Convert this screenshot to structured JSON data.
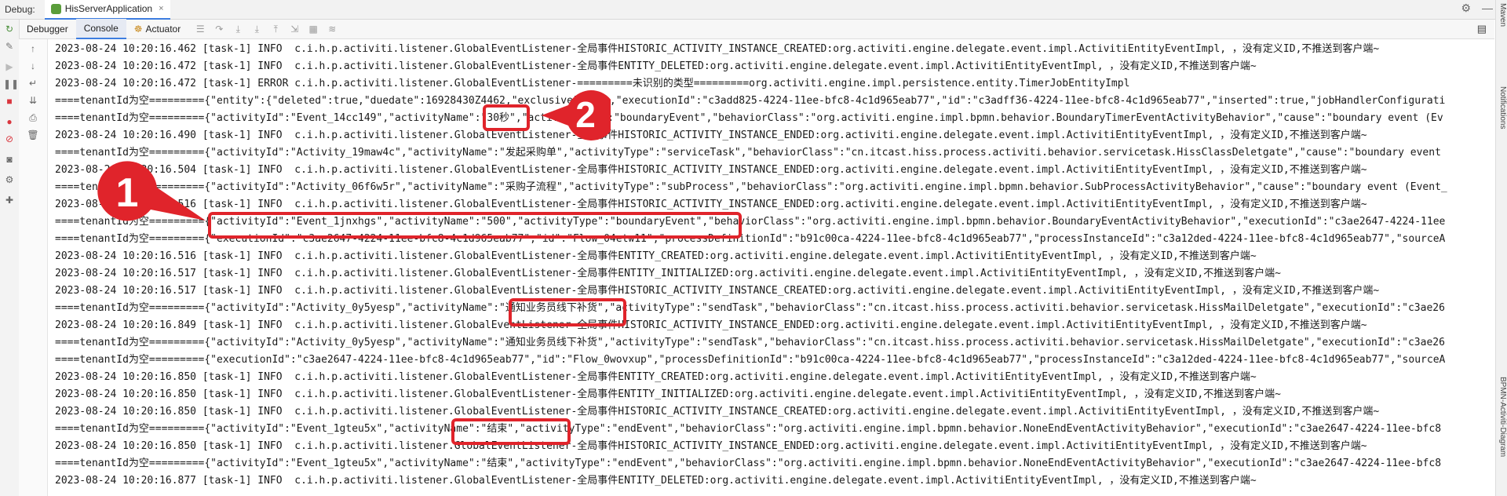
{
  "header": {
    "debug_label": "Debug:",
    "app_tab": "HisServerApplication",
    "close_symbol": "×",
    "settings_icon": "gear-icon",
    "minimize_icon": "minus-icon"
  },
  "toolbar": {
    "tabs": [
      "Debugger",
      "Console",
      "Actuator"
    ],
    "active_tab": "Console"
  },
  "right_panels": {
    "top": "Maven",
    "middle": "Notifications",
    "bottom": "BPMN-Activiti-Diagram"
  },
  "annotations": {
    "badge_1": "1",
    "badge_2": "2",
    "color": "#e0242b"
  },
  "console": {
    "lines": [
      "2023-08-24 10:20:16.462 [task-1] INFO  c.i.h.p.activiti.listener.GlobalEventListener-全局事件HISTORIC_ACTIVITY_INSTANCE_CREATED:org.activiti.engine.delegate.event.impl.ActivitiEntityEventImpl, ，没有定义ID,不推送到客户端~",
      "2023-08-24 10:20:16.472 [task-1] INFO  c.i.h.p.activiti.listener.GlobalEventListener-全局事件ENTITY_DELETED:org.activiti.engine.delegate.event.impl.ActivitiEntityEventImpl, ，没有定义ID,不推送到客户端~",
      "2023-08-24 10:20:16.472 [task-1] ERROR c.i.h.p.activiti.listener.GlobalEventListener-=========未识别的类型=========org.activiti.engine.impl.persistence.entity.TimerJobEntityImpl",
      "====tenantId为空========={\"entity\":{\"deleted\":true,\"duedate\":16928430Z4462,\"exclusive\":true,\"executionId\":\"c3add825-4224-11ee-bfc8-4c1d965eab77\",\"id\":\"c3adff36-4224-11ee-bfc8-4c1d965eab77\",\"inserted\":true,\"jobHandlerConfigurati",
      "====tenantId为空========={\"activityId\":\"Event_14cc149\",\"activityName\":\"30秒\",\"activityType\":\"boundaryEvent\",\"behaviorClass\":\"org.activiti.engine.impl.bpmn.behavior.BoundaryTimerEventActivityBehavior\",\"cause\":\"boundary event (Ev",
      "2023-08-24 10:20:16.490 [task-1] INFO  c.i.h.p.activiti.listener.GlobalEventListener-全局事件HISTORIC_ACTIVITY_INSTANCE_ENDED:org.activiti.engine.delegate.event.impl.ActivitiEntityEventImpl, ，没有定义ID,不推送到客户端~",
      "====tenantId为空========={\"activityId\":\"Activity_19maw4c\",\"activityName\":\"发起采购单\",\"activityType\":\"serviceTask\",\"behaviorClass\":\"cn.itcast.hiss.process.activiti.behavior.servicetask.HissClassDeletgate\",\"cause\":\"boundary event",
      "2023-08-24 10:20:16.504 [task-1] INFO  c.i.h.p.activiti.listener.GlobalEventListener-全局事件HISTORIC_ACTIVITY_INSTANCE_ENDED:org.activiti.engine.delegate.event.impl.ActivitiEntityEventImpl, ，没有定义ID,不推送到客户端~",
      "====tenantId为空========={\"activityId\":\"Activity_06f6w5r\",\"activityName\":\"采购子流程\",\"activityType\":\"subProcess\",\"behaviorClass\":\"org.activiti.engine.impl.bpmn.behavior.SubProcessActivityBehavior\",\"cause\":\"boundary event (Event_",
      "2023-08-24 10:20:16.516 [task-1] INFO  c.i.h.p.activiti.listener.GlobalEventListener-全局事件HISTORIC_ACTIVITY_INSTANCE_ENDED:org.activiti.engine.delegate.event.impl.ActivitiEntityEventImpl, ，没有定义ID,不推送到客户端~",
      "====tenantId为空========={\"activityId\":\"Event_1jnxhgs\",\"activityName\":\"500\",\"activityType\":\"boundaryEvent\",\"behaviorClass\":\"org.activiti.engine.impl.bpmn.behavior.BoundaryEventActivityBehavior\",\"executionId\":\"c3ae2647-4224-11ee",
      "====tenantId为空========={\"executionId\":\"c3ae2647-4224-11ee-bfc8-4c1d965eab77\",\"id\":\"Flow_04etw11\",\"processDefinitionId\":\"b91c00ca-4224-11ee-bfc8-4c1d965eab77\",\"processInstanceId\":\"c3a12ded-4224-11ee-bfc8-4c1d965eab77\",\"sourceA",
      "2023-08-24 10:20:16.516 [task-1] INFO  c.i.h.p.activiti.listener.GlobalEventListener-全局事件ENTITY_CREATED:org.activiti.engine.delegate.event.impl.ActivitiEntityEventImpl, ，没有定义ID,不推送到客户端~",
      "2023-08-24 10:20:16.517 [task-1] INFO  c.i.h.p.activiti.listener.GlobalEventListener-全局事件ENTITY_INITIALIZED:org.activiti.engine.delegate.event.impl.ActivitiEntityEventImpl, ，没有定义ID,不推送到客户端~",
      "2023-08-24 10:20:16.517 [task-1] INFO  c.i.h.p.activiti.listener.GlobalEventListener-全局事件HISTORIC_ACTIVITY_INSTANCE_CREATED:org.activiti.engine.delegate.event.impl.ActivitiEntityEventImpl, ，没有定义ID,不推送到客户端~",
      "====tenantId为空========={\"activityId\":\"Activity_0y5yesp\",\"activityName\":\"通知业务员线下补货\",\"activityType\":\"sendTask\",\"behaviorClass\":\"cn.itcast.hiss.process.activiti.behavior.servicetask.HissMailDeletgate\",\"executionId\":\"c3ae26",
      "2023-08-24 10:20:16.849 [task-1] INFO  c.i.h.p.activiti.listener.GlobalEventListener-全局事件HISTORIC_ACTIVITY_INSTANCE_ENDED:org.activiti.engine.delegate.event.impl.ActivitiEntityEventImpl, ，没有定义ID,不推送到客户端~",
      "====tenantId为空========={\"activityId\":\"Activity_0y5yesp\",\"activityName\":\"通知业务员线下补货\",\"activityType\":\"sendTask\",\"behaviorClass\":\"cn.itcast.hiss.process.activiti.behavior.servicetask.HissMailDeletgate\",\"executionId\":\"c3ae26",
      "====tenantId为空========={\"executionId\":\"c3ae2647-4224-11ee-bfc8-4c1d965eab77\",\"id\":\"Flow_0wovxup\",\"processDefinitionId\":\"b91c00ca-4224-11ee-bfc8-4c1d965eab77\",\"processInstanceId\":\"c3a12ded-4224-11ee-bfc8-4c1d965eab77\",\"sourceA",
      "2023-08-24 10:20:16.850 [task-1] INFO  c.i.h.p.activiti.listener.GlobalEventListener-全局事件ENTITY_CREATED:org.activiti.engine.delegate.event.impl.ActivitiEntityEventImpl, ，没有定义ID,不推送到客户端~",
      "2023-08-24 10:20:16.850 [task-1] INFO  c.i.h.p.activiti.listener.GlobalEventListener-全局事件ENTITY_INITIALIZED:org.activiti.engine.delegate.event.impl.ActivitiEntityEventImpl, ，没有定义ID,不推送到客户端~",
      "2023-08-24 10:20:16.850 [task-1] INFO  c.i.h.p.activiti.listener.GlobalEventListener-全局事件HISTORIC_ACTIVITY_INSTANCE_CREATED:org.activiti.engine.delegate.event.impl.ActivitiEntityEventImpl, ，没有定义ID,不推送到客户端~",
      "====tenantId为空========={\"activityId\":\"Event_1gteu5x\",\"activityName\":\"结束\",\"activityType\":\"endEvent\",\"behaviorClass\":\"org.activiti.engine.impl.bpmn.behavior.NoneEndEventActivityBehavior\",\"executionId\":\"c3ae2647-4224-11ee-bfc8",
      "2023-08-24 10:20:16.850 [task-1] INFO  c.i.h.p.activiti.listener.GlobalEventListener-全局事件HISTORIC_ACTIVITY_INSTANCE_ENDED:org.activiti.engine.delegate.event.impl.ActivitiEntityEventImpl, ，没有定义ID,不推送到客户端~",
      "====tenantId为空========={\"activityId\":\"Event_1gteu5x\",\"activityName\":\"结束\",\"activityType\":\"endEvent\",\"behaviorClass\":\"org.activiti.engine.impl.bpmn.behavior.NoneEndEventActivityBehavior\",\"executionId\":\"c3ae2647-4224-11ee-bfc8",
      "2023-08-24 10:20:16.877 [task-1] INFO  c.i.h.p.activiti.listener.GlobalEventListener-全局事件ENTITY_DELETED:org.activiti.engine.delegate.event.impl.ActivitiEntityEventImpl, ，没有定义ID,不推送到客户端~"
    ]
  }
}
